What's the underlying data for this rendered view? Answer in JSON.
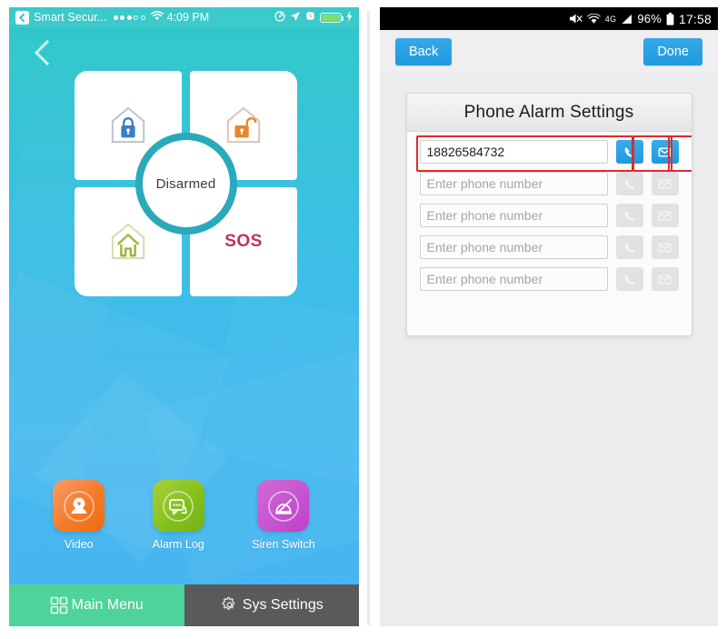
{
  "left_phone": {
    "status_bar": {
      "back_chip_icon": "back-chip-icon",
      "carrier": "Smart Secur...",
      "signal_icon": "signal-dots-icon",
      "wifi_icon": "wifi-icon",
      "time": "4:09 PM",
      "rotation_lock_icon": "rotation-lock-icon",
      "location_icon": "location-arrow-icon",
      "alarm_icon": "alarm-clock-icon",
      "battery_icon": "battery-full-icon",
      "charging_icon": "charging-bolt-icon"
    },
    "nav": {
      "back_icon": "back-chevron-icon"
    },
    "arm_panel": {
      "status_label": "Disarmed",
      "quadrants": [
        {
          "name": "arm-away",
          "icon": "house-locked-icon",
          "color": "#3b7fc4",
          "label": ""
        },
        {
          "name": "disarm",
          "icon": "house-unlocked-icon",
          "color": "#e8872a",
          "label": ""
        },
        {
          "name": "arm-home",
          "icon": "house-home-icon",
          "color": "#9eb83a",
          "label": ""
        },
        {
          "name": "sos",
          "icon": "sos-text-icon",
          "color": "#c2315a",
          "label": "SOS"
        }
      ],
      "ring_color": "#2aa9bb"
    },
    "features": [
      {
        "label": "Video",
        "icon": "camera-icon",
        "color": "#f47c28"
      },
      {
        "label": "Alarm Log",
        "icon": "chat-log-icon",
        "color": "#86c01e"
      },
      {
        "label": "Siren Switch",
        "icon": "siren-off-icon",
        "color": "#c655cf"
      }
    ],
    "tabs": [
      {
        "label": "Main Menu",
        "icon": "grid-icon",
        "color": "#4ed39a",
        "active": true
      },
      {
        "label": "Sys Settings",
        "icon": "gear-icon",
        "color": "#5a5a5a",
        "active": false
      }
    ]
  },
  "right_phone": {
    "status_bar": {
      "mute_icon": "speaker-mute-icon",
      "wifi_icon": "wifi-icon",
      "network_label": "4G",
      "signal_icon": "signal-bars-icon",
      "battery_percent": "96%",
      "battery_icon": "battery-full-icon",
      "time": "17:58"
    },
    "toolbar": {
      "back_label": "Back",
      "done_label": "Done"
    },
    "card": {
      "title": "Phone Alarm Settings",
      "rows": [
        {
          "value": "18826584732",
          "placeholder": "Enter phone number",
          "call_icon": "phone-handset-icon",
          "sms_icon": "envelope-icon",
          "enabled": true,
          "highlighted": true
        },
        {
          "value": "",
          "placeholder": "Enter phone number",
          "call_icon": "phone-handset-icon",
          "sms_icon": "envelope-icon",
          "enabled": false,
          "highlighted": false
        },
        {
          "value": "",
          "placeholder": "Enter phone number",
          "call_icon": "phone-handset-icon",
          "sms_icon": "envelope-icon",
          "enabled": false,
          "highlighted": false
        },
        {
          "value": "",
          "placeholder": "Enter phone number",
          "call_icon": "phone-handset-icon",
          "sms_icon": "envelope-icon",
          "enabled": false,
          "highlighted": false
        },
        {
          "value": "",
          "placeholder": "Enter phone number",
          "call_icon": "phone-handset-icon",
          "sms_icon": "envelope-icon",
          "enabled": false,
          "highlighted": false
        }
      ]
    }
  },
  "colors": {
    "accent_blue": "#2099e0",
    "highlight_red": "#e02a2a",
    "teal": "#2fc6c6",
    "sky": "#48b5f1",
    "green_tab": "#4ed39a",
    "dark_tab": "#5a5a5a"
  }
}
